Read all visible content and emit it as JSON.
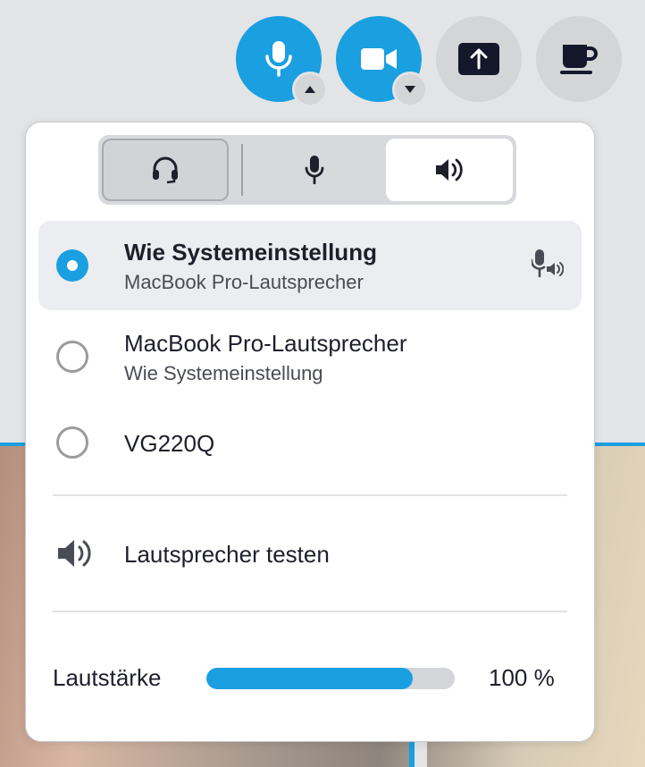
{
  "controls": {
    "mic_icon": "microphone-icon",
    "camera_icon": "video-camera-icon",
    "share_icon": "screen-share-icon",
    "break_icon": "coffee-cup-icon",
    "mic_caret": "caret-up-icon",
    "camera_caret": "caret-down-icon"
  },
  "popover": {
    "tabs": [
      {
        "icon": "headset-icon"
      },
      {
        "icon": "microphone-icon"
      },
      {
        "icon": "speaker-icon",
        "selected": true
      }
    ],
    "devices": [
      {
        "title": "Wie Systemeinstellung",
        "subtitle": "MacBook Pro-Lautsprecher",
        "selected": true,
        "icon": "mic-speaker-icon"
      },
      {
        "title": "MacBook Pro-Lautsprecher",
        "subtitle": "Wie Systemeinstellung",
        "selected": false
      },
      {
        "title": "VG220Q",
        "selected": false
      }
    ],
    "test_label": "Lautsprecher testen",
    "volume": {
      "label": "Lautstärke",
      "value_text": "100 %",
      "level": 0.83
    }
  },
  "colors": {
    "accent": "#1a9fe0",
    "background": "#e3e4e6"
  }
}
